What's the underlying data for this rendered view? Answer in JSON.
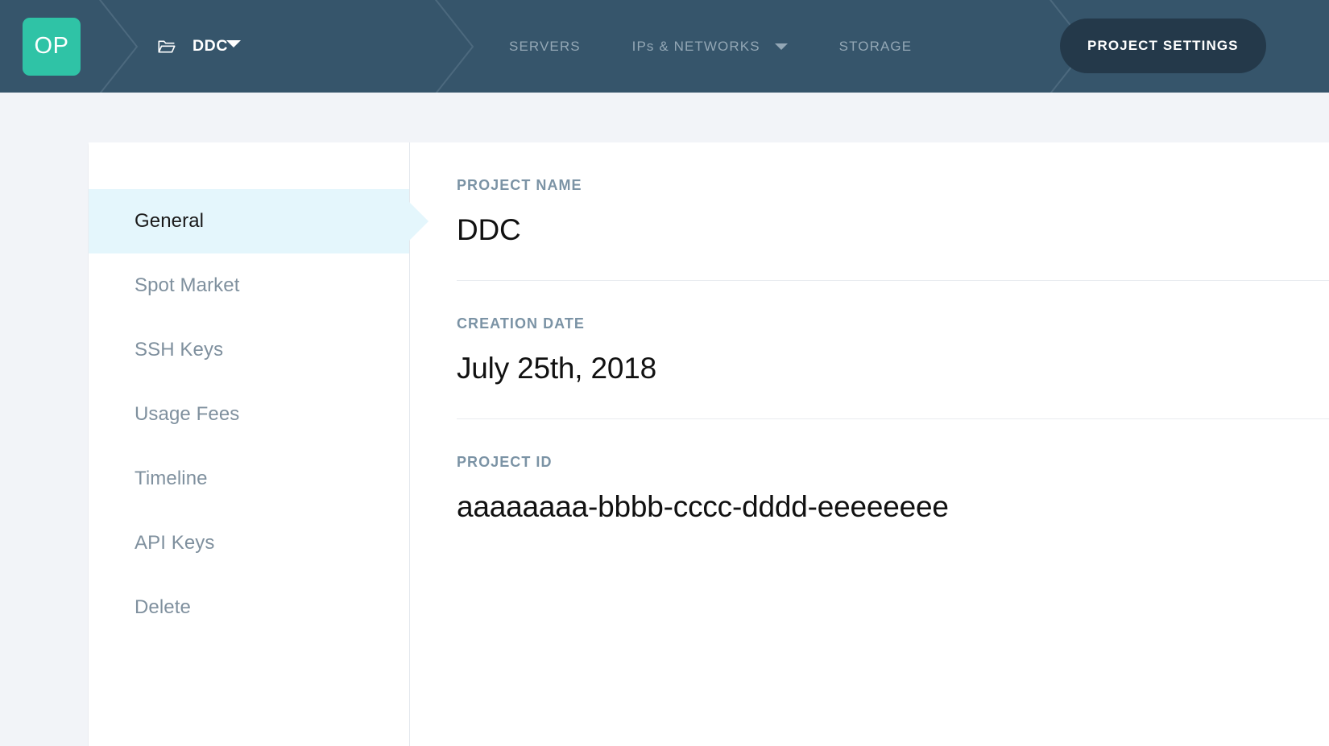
{
  "topnav": {
    "logo_text": "OP",
    "logo_color": "#2fc3a6",
    "background_color": "#36556b",
    "folder_icon": "folder-open-icon",
    "project_name": "DDC",
    "project_caret_icon": "chevron-down-icon",
    "links": [
      {
        "label": "SERVERS",
        "has_caret": false
      },
      {
        "label": "IPs & NETWORKS",
        "has_caret": true
      },
      {
        "label": "STORAGE",
        "has_caret": false
      }
    ],
    "active_pill": {
      "label": "PROJECT SETTINGS",
      "background_color": "#24394a"
    }
  },
  "sidebar": {
    "active_background": "#e4f6fc",
    "items": [
      {
        "label": "General",
        "active": true
      },
      {
        "label": "Spot Market",
        "active": false
      },
      {
        "label": "SSH Keys",
        "active": false
      },
      {
        "label": "Usage Fees",
        "active": false
      },
      {
        "label": "Timeline",
        "active": false
      },
      {
        "label": "API Keys",
        "active": false
      },
      {
        "label": "Delete",
        "active": false
      }
    ]
  },
  "detail": {
    "fields": [
      {
        "label": "PROJECT NAME",
        "value": "DDC"
      },
      {
        "label": "CREATION DATE",
        "value": "July 25th, 2018"
      },
      {
        "label": "PROJECT ID",
        "value": "aaaaaaaa-bbbb-cccc-dddd-eeeeeeee"
      }
    ]
  }
}
